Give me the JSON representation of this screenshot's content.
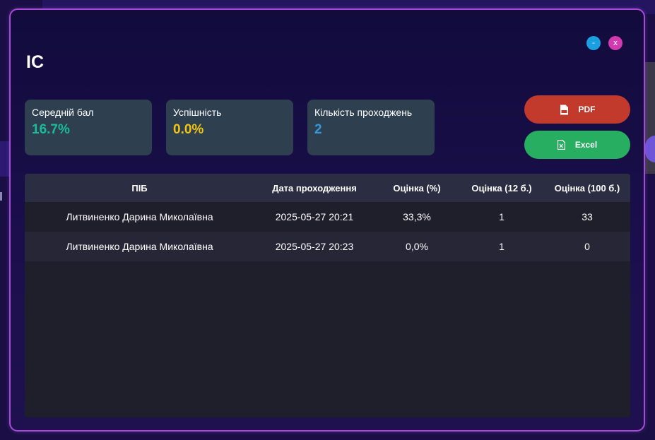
{
  "window": {
    "title": "IC",
    "minimize_label": "-",
    "close_label": "x"
  },
  "stats": [
    {
      "label": "Середній бал",
      "value": "16.7%",
      "color": "#1abc9c"
    },
    {
      "label": "Успішність",
      "value": "0.0%",
      "color": "#f1c40f"
    },
    {
      "label": "Кількість проходжень",
      "value": "2",
      "color": "#3498db"
    }
  ],
  "actions": {
    "pdf_label": "PDF",
    "pdf_icon": "pdf-file-icon",
    "excel_label": "Excel",
    "excel_icon": "excel-file-icon"
  },
  "table": {
    "headers": [
      "ПІБ",
      "Дата проходження",
      "Оцінка (%)",
      "Оцінка (12 б.)",
      "Оцінка (100 б.)"
    ],
    "rows": [
      [
        "Литвиненко Дарина Миколаївна",
        "2025-05-27 20:21",
        "33,3%",
        "1",
        "33"
      ],
      [
        "Литвиненко Дарина Миколаївна",
        "2025-05-27 20:23",
        "0,0%",
        "1",
        "0"
      ]
    ]
  },
  "colors": {
    "accent_border": "#a64ad8",
    "pdf_button": "#c23a2c",
    "excel_button": "#27ae60"
  }
}
